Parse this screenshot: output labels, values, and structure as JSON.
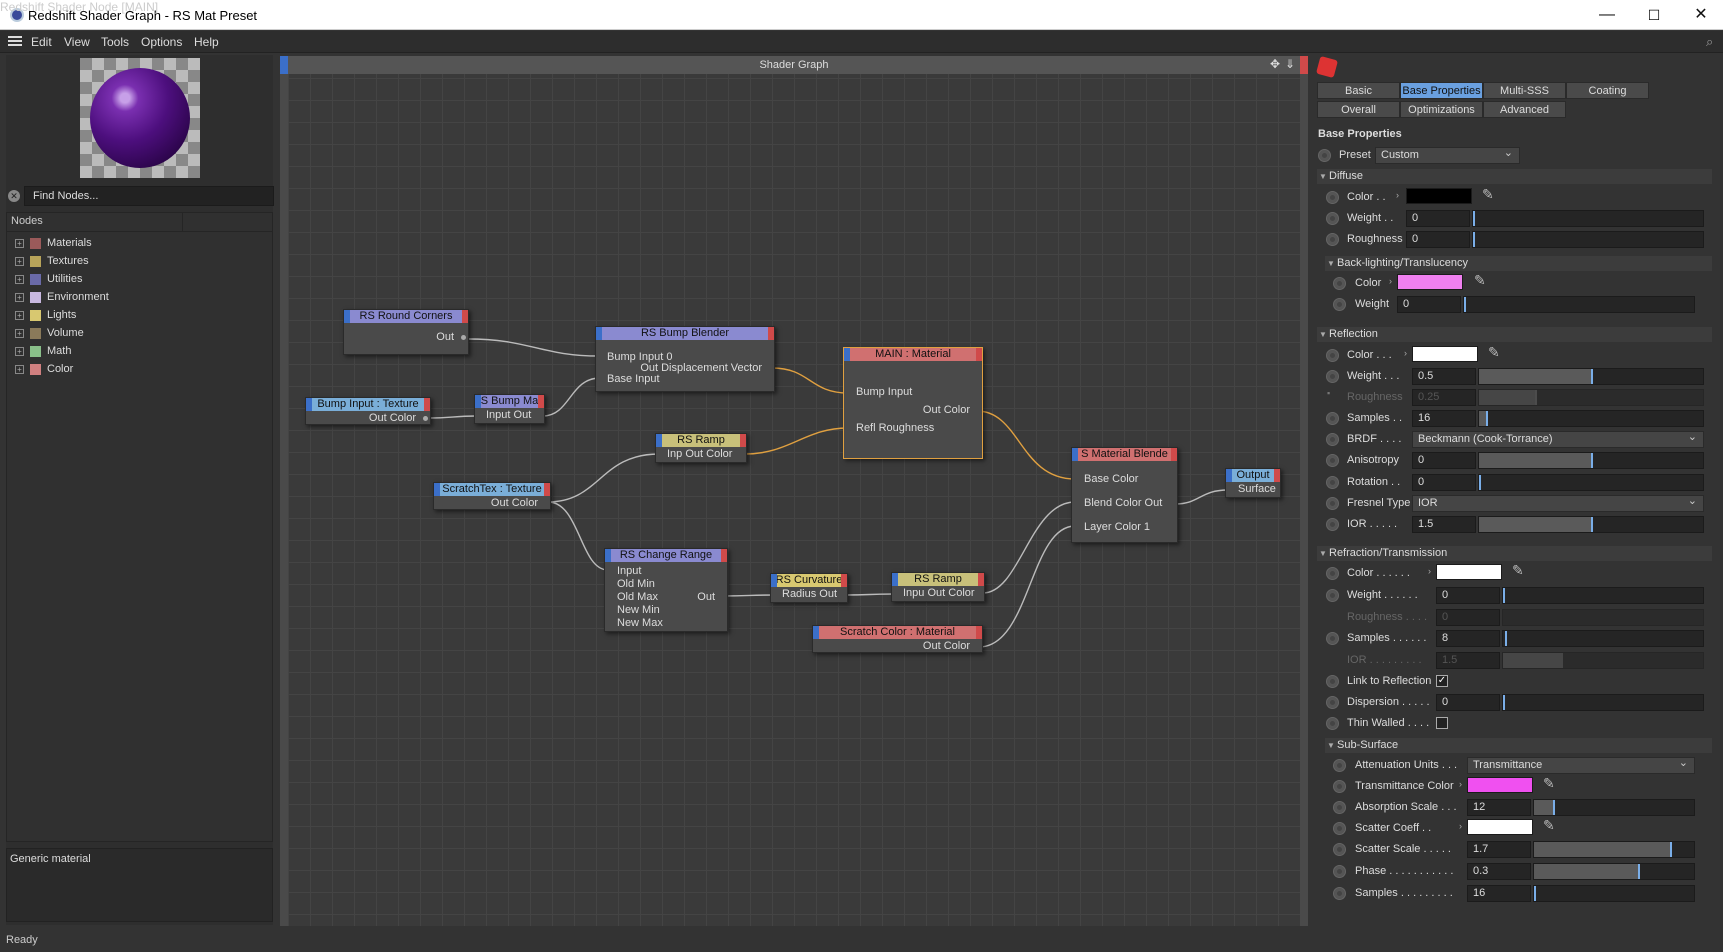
{
  "window": {
    "title": "Redshift Shader Graph - RS Mat Preset",
    "min": "—",
    "max": "☐",
    "close": "✕"
  },
  "menu": [
    "Edit",
    "View",
    "Tools",
    "Options",
    "Help"
  ],
  "left": {
    "find_placeholder": "Find Nodes...",
    "nodes_header": "Nodes",
    "categories": [
      {
        "label": "Materials",
        "color": "#9a5a5a"
      },
      {
        "label": "Textures",
        "color": "#b8a45a"
      },
      {
        "label": "Utilities",
        "color": "#6a6aa8"
      },
      {
        "label": "Environment",
        "color": "#c8b8e0"
      },
      {
        "label": "Lights",
        "color": "#d8c870"
      },
      {
        "label": "Volume",
        "color": "#8a7a5a"
      },
      {
        "label": "Math",
        "color": "#8ac08a"
      },
      {
        "label": "Color",
        "color": "#d08080"
      }
    ],
    "description": "Generic material",
    "status": "Ready"
  },
  "graph": {
    "title": "Shader Graph",
    "nodes": {
      "round": {
        "title": "RS Round Corners",
        "color": "#8a8ad0",
        "out": "Out"
      },
      "bumpin": {
        "title": "Bump Input : Texture",
        "color": "#7aaed8",
        "out": "Out Color"
      },
      "bumpmap": {
        "title": "S Bump Ma",
        "color": "#8a8ad0",
        "io": "Input Out"
      },
      "blender": {
        "title": "RS Bump Blender",
        "color": "#8a8ad0",
        "p1": "Bump Input 0",
        "p2": "Out Displacement Vector",
        "p3": "Base Input"
      },
      "ramp1": {
        "title": "RS Ramp",
        "color": "#c8c07a",
        "io": "Inp Out Color"
      },
      "scratch": {
        "title": "ScratchTex : Texture",
        "color": "#7aaed8",
        "out": "Out Color"
      },
      "main": {
        "title": "MAIN : Material",
        "color": "#d07070",
        "p1": "Bump Input",
        "p2": "Out Color",
        "p3": "Refl Roughness"
      },
      "change": {
        "title": "RS Change Range",
        "color": "#8a8ad0",
        "inputs": [
          "Input",
          "Old Min",
          "Old Max",
          "New Min",
          "New Max"
        ],
        "out": "Out"
      },
      "curv": {
        "title": "RS Curvature",
        "color": "#d8c870",
        "io": "Radius Out"
      },
      "ramp2": {
        "title": "RS Ramp",
        "color": "#c8c07a",
        "io": "Inpu Out Color"
      },
      "scolor": {
        "title": "Scratch Color : Material",
        "color": "#d07070",
        "out": "Out Color"
      },
      "mblend": {
        "title": "S Material Blende",
        "color": "#d07070",
        "p1": "Base Color",
        "p2": "Blend Color Out",
        "p3": "Layer Color 1"
      },
      "output": {
        "title": "Output",
        "color": "#7aaed8",
        "in": "Surface"
      }
    }
  },
  "props": {
    "header": "Redshift Shader Node [MAIN]",
    "tabs1": [
      "Basic",
      "Base Properties",
      "Multi-SSS",
      "Coating"
    ],
    "tabs2": [
      "Overall",
      "Optimizations",
      "Advanced"
    ],
    "section": "Base Properties",
    "preset_label": "Preset",
    "preset": "Custom",
    "diffuse": {
      "title": "Diffuse",
      "color": "Color . .",
      "color_val": "#000000",
      "weight": "Weight . .",
      "weight_v": "0",
      "rough": "Roughness",
      "rough_v": "0"
    },
    "back": {
      "title": "Back-lighting/Translucency",
      "color": "Color",
      "color_val": "#f080f0",
      "weight": "Weight",
      "weight_v": "0"
    },
    "refl": {
      "title": "Reflection",
      "color": "Color . . .",
      "color_val": "#ffffff",
      "weight": "Weight . . .",
      "weight_v": "0.5",
      "rough": "Roughness",
      "rough_v": "0.25",
      "samples": "Samples . .",
      "samples_v": "16",
      "brdf": "BRDF . . . .",
      "brdf_v": "Beckmann (Cook-Torrance)",
      "aniso": "Anisotropy",
      "aniso_v": "0",
      "rot": "Rotation . .",
      "rot_v": "0",
      "fresnel": "Fresnel Type",
      "fresnel_v": "IOR",
      "ior": "IOR . . . . .",
      "ior_v": "1.5"
    },
    "refr": {
      "title": "Refraction/Transmission",
      "color": "Color . . . . . .",
      "color_val": "#ffffff",
      "weight": "Weight . . . . . .",
      "weight_v": "0",
      "rough": "Roughness . . . .",
      "rough_v": "0",
      "samples": "Samples . . . . . .",
      "samples_v": "8",
      "ior": "IOR . . . . . . . . .",
      "ior_v": "1.5",
      "link": "Link to Reflection",
      "disp": "Dispersion . . . . .",
      "disp_v": "0",
      "thin": "Thin Walled . . . ."
    },
    "sss": {
      "title": "Sub-Surface",
      "units": "Attenuation Units . . .",
      "units_v": "Transmittance",
      "tcolor": "Transmittance Color",
      "tcolor_val": "#f050f0",
      "abs": "Absorption Scale . . .",
      "abs_v": "12",
      "scoef": "Scatter Coeff . .",
      "scoef_val": "#ffffff",
      "sscale": "Scatter Scale . . . . .",
      "sscale_v": "1.7",
      "phase": "Phase . . . . . . . . . . .",
      "phase_v": "0.3",
      "samples": "Samples . . . . . . . . .",
      "samples_v": "16"
    }
  }
}
